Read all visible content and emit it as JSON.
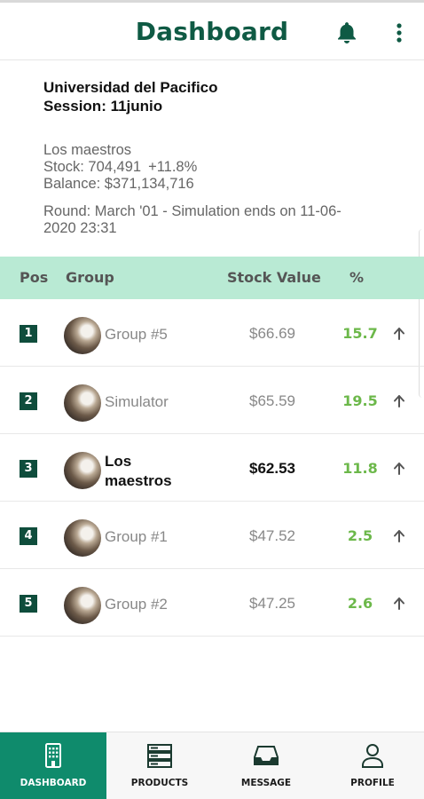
{
  "header": {
    "title": "Dashboard",
    "bell_icon": "bell-icon",
    "menu_icon": "more-vertical-icon"
  },
  "info": {
    "university": "Universidad del Pacifico",
    "session": "Session: 11junio",
    "team": "Los maestros",
    "stock_label": "Stock: 704,491",
    "stock_change": "+11.8%",
    "balance": "Balance: $371,134,716",
    "round": "Round: March '01 - Simulation ends on 11-06-2020 23:31"
  },
  "table": {
    "headers": {
      "pos": "Pos",
      "group": "Group",
      "value": "Stock Value",
      "pct": "%"
    },
    "rows": [
      {
        "pos": "1",
        "group": "Group #5",
        "value": "$66.69",
        "pct": "15.7",
        "trend": "up"
      },
      {
        "pos": "2",
        "group": "Simulator",
        "value": "$65.59",
        "pct": "19.5",
        "trend": "up"
      },
      {
        "pos": "3",
        "group": "Los maestros",
        "value": "$62.53",
        "pct": "11.8",
        "trend": "up",
        "current": true
      },
      {
        "pos": "4",
        "group": "Group #1",
        "value": "$47.52",
        "pct": "2.5",
        "trend": "up"
      },
      {
        "pos": "5",
        "group": "Group #2",
        "value": "$47.25",
        "pct": "2.6",
        "trend": "up"
      }
    ]
  },
  "nav": [
    {
      "label": "DASHBOARD",
      "icon": "building-icon",
      "active": true
    },
    {
      "label": "PRODUCTS",
      "icon": "server-icon",
      "active": false
    },
    {
      "label": "MESSAGE",
      "icon": "inbox-icon",
      "active": false
    },
    {
      "label": "PROFILE",
      "icon": "user-icon",
      "active": false
    }
  ],
  "colors": {
    "brand": "#0f5a44",
    "header_row": "#b9ead4",
    "positive": "#6cb84a",
    "nav_active": "#0f8b6c",
    "pos_badge": "#0f4d3c"
  }
}
